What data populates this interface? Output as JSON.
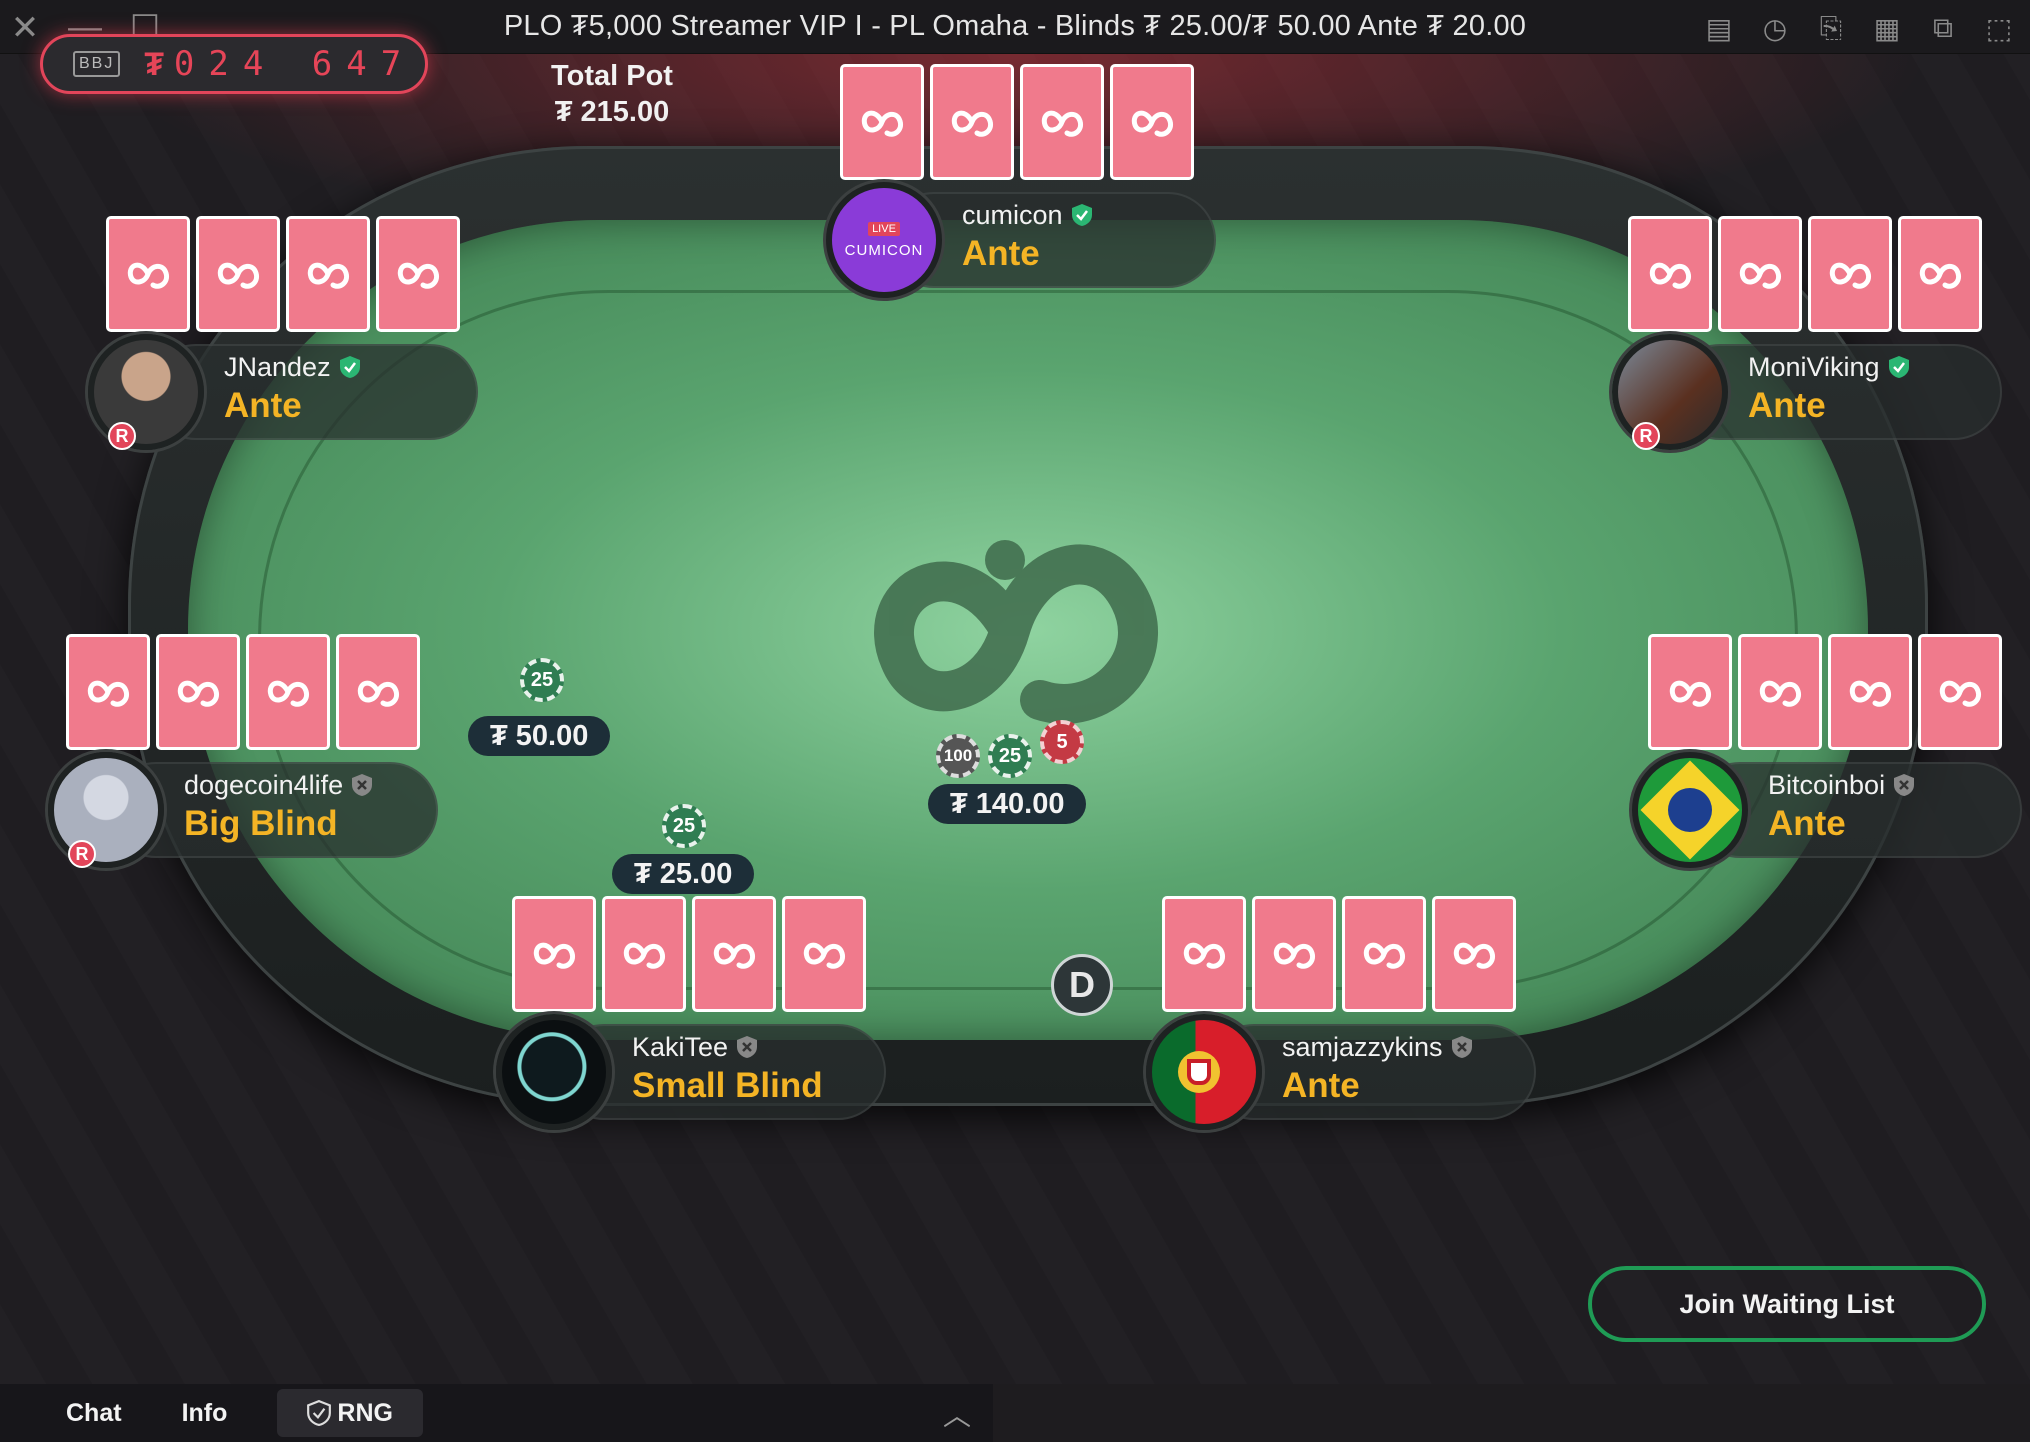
{
  "window": {
    "title": "PLO ₮5,000 Streamer VIP I - PL Omaha - Blinds ₮ 25.00/₮ 50.00 Ante ₮ 20.00",
    "controls_left": [
      "✕",
      "—",
      "☐"
    ],
    "controls_right": [
      "▤",
      "◷",
      "⎘",
      "▦",
      "⧉",
      "⬚"
    ]
  },
  "jackpot": {
    "badge": "BBJ",
    "currency": "₮",
    "digits": "024 647"
  },
  "pot": {
    "label": "Total Pot",
    "amount": "₮ 215.00",
    "center_bet": "₮ 140.00"
  },
  "seats": [
    {
      "name": "cumicon",
      "action": "Ante",
      "verified": true,
      "avatar_text": "CUMICON",
      "live": "LIVE"
    },
    {
      "name": "JNandez",
      "action": "Ante",
      "verified": true,
      "badge": "R"
    },
    {
      "name": "MoniViking",
      "action": "Ante",
      "verified": true,
      "badge": "R"
    },
    {
      "name": "dogecoin4life",
      "action": "Big Blind",
      "verified": false,
      "badge": "R",
      "bet": "₮ 50.00",
      "chip": "25"
    },
    {
      "name": "Bitcoinboi",
      "action": "Ante",
      "verified": false
    },
    {
      "name": "KakiTee",
      "action": "Small Blind",
      "verified": false,
      "bet": "₮ 25.00",
      "chip": "25"
    },
    {
      "name": "samjazzykins",
      "action": "Ante",
      "verified": false
    }
  ],
  "center_chips": [
    "100",
    "25",
    "5"
  ],
  "dealer_button": "D",
  "join_waiting_list": "Join Waiting List",
  "bottom_tabs": [
    "Chat",
    "Info",
    "RNG"
  ],
  "colors": {
    "accent": "#e2455a",
    "felt": "#5aa46f",
    "action": "#f4b425",
    "join_border": "#1f9b55",
    "card_back": "#f07a8c"
  }
}
